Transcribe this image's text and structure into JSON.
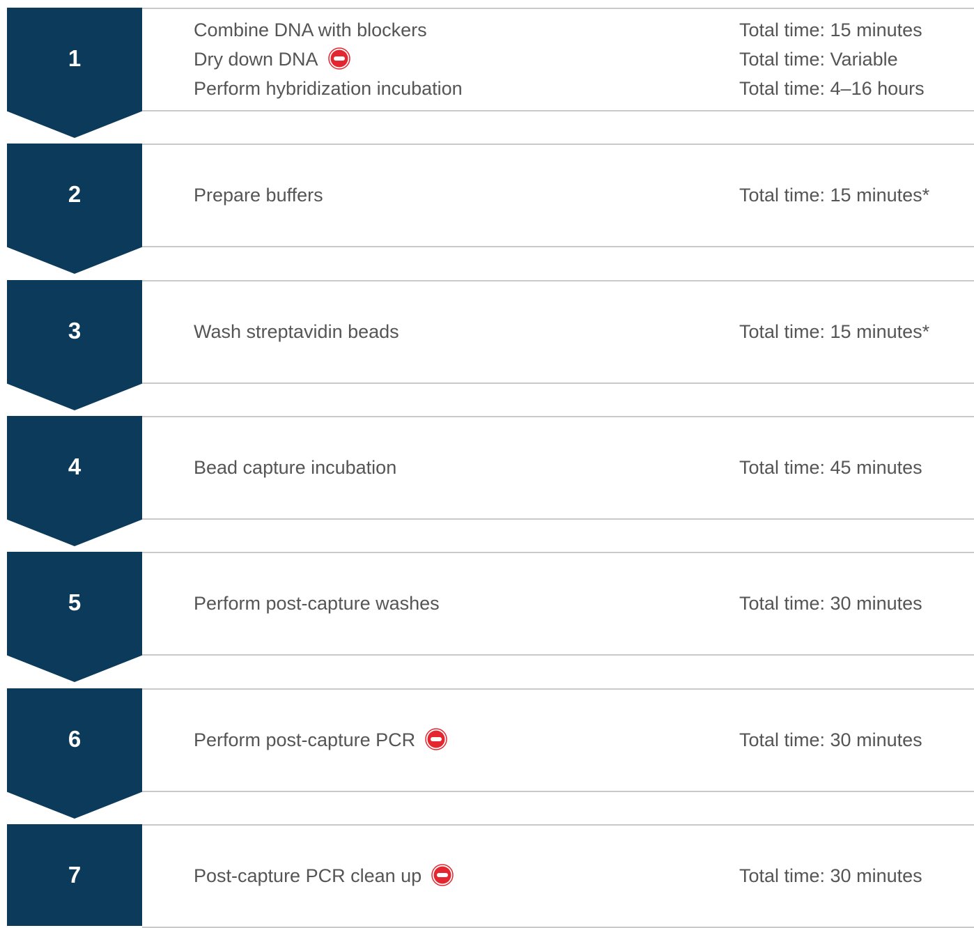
{
  "colors": {
    "marker": "#0b3a5b",
    "text": "#555555",
    "divider": "#c9c9c9",
    "stop_icon": "#e3262f"
  },
  "icons": {
    "stop": "stop-icon"
  },
  "steps": [
    {
      "number": "1",
      "tasks": [
        {
          "name": "Combine DNA with blockers",
          "time": "Total time: 15 minutes",
          "stop": false
        },
        {
          "name": "Dry down DNA",
          "time": "Total time: Variable",
          "stop": true
        },
        {
          "name": "Perform hybridization incubation",
          "time": "Total time: 4–16 hours",
          "stop": false
        }
      ]
    },
    {
      "number": "2",
      "tasks": [
        {
          "name": "Prepare buffers",
          "time": "Total time: 15 minutes*",
          "stop": false
        }
      ]
    },
    {
      "number": "3",
      "tasks": [
        {
          "name": "Wash streptavidin beads",
          "time": "Total time: 15 minutes*",
          "stop": false
        }
      ]
    },
    {
      "number": "4",
      "tasks": [
        {
          "name": "Bead capture incubation",
          "time": "Total time: 45 minutes",
          "stop": false
        }
      ]
    },
    {
      "number": "5",
      "tasks": [
        {
          "name": "Perform post-capture washes",
          "time": "Total time: 30 minutes",
          "stop": false
        }
      ]
    },
    {
      "number": "6",
      "tasks": [
        {
          "name": "Perform post-capture PCR",
          "time": "Total time: 30 minutes",
          "stop": true
        }
      ]
    },
    {
      "number": "7",
      "tasks": [
        {
          "name": "Post-capture PCR clean up",
          "time": "Total time: 30 minutes",
          "stop": true
        }
      ]
    }
  ]
}
